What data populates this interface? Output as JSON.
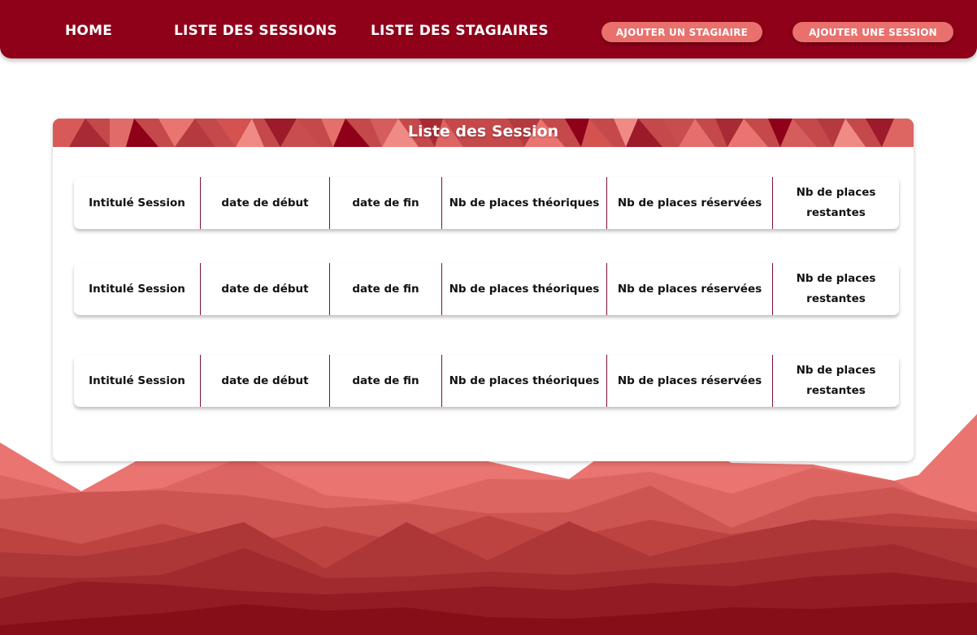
{
  "nav": {
    "links": [
      "HOME",
      "LISTE DES SESSIONS",
      "LISTE DES STAGIAIRES"
    ],
    "buttons": [
      "AJOUTER UN STAGIAIRE",
      "AJOUTER UNE SESSION"
    ]
  },
  "card": {
    "title": "Liste des Session",
    "rows": [
      [
        "Intitulé Session",
        "date de début",
        "date de fin",
        "Nb de places théoriques",
        "Nb de places réservées",
        "Nb de places restantes"
      ],
      [
        "Intitulé Session",
        "date de début",
        "date de fin",
        "Nb de places théoriques",
        "Nb de places réservées",
        "Nb de places restantes"
      ],
      [
        "Intitulé Session",
        "date de début",
        "date de fin",
        "Nb de places théoriques",
        "Nb de places réservées",
        "Nb de places restantes"
      ]
    ]
  },
  "colors": {
    "primary": "#8f0019",
    "accent": "#e9706c",
    "mountain_light": "#e8706c",
    "mountain_dark": "#960e1c"
  }
}
